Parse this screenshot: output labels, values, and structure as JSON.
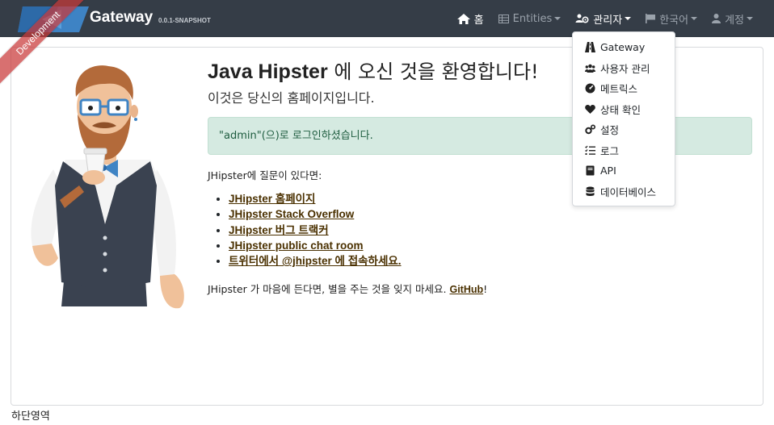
{
  "brand": {
    "title": "Gateway",
    "version": "0.0.1-SNAPSHOT",
    "ribbon": "Development"
  },
  "nav": {
    "home": "홈",
    "entities": "Entities",
    "admin": "관리자",
    "language": "한국어",
    "account": "계정"
  },
  "admin_menu": {
    "items": [
      {
        "label": "Gateway",
        "icon": "road-icon"
      },
      {
        "label": "사용자 관리",
        "icon": "users-icon"
      },
      {
        "label": "메트릭스",
        "icon": "tachometer-icon"
      },
      {
        "label": "상태 확인",
        "icon": "heart-icon"
      },
      {
        "label": "설정",
        "icon": "cogs-icon"
      },
      {
        "label": "로그",
        "icon": "tasks-icon"
      },
      {
        "label": "API",
        "icon": "book-icon"
      },
      {
        "label": "데이터베이스",
        "icon": "database-icon"
      }
    ]
  },
  "home": {
    "title_bold": "Java Hipster",
    "title_rest": " 에 오신 것을 환영합니다!",
    "subtitle": "이것은 당신의 홈페이지입니다.",
    "alert": "\"admin\"(으)로 로그인하셨습니다.",
    "question": "JHipster에 질문이 있다면:",
    "links": [
      "JHipster 홈페이지",
      "JHipster Stack Overflow",
      "JHipster 버그 트랙커",
      "JHipster public chat room",
      "트위터에서 @jhipster 에 접속하세요."
    ],
    "github_text": "JHipster 가 마음에 든다면, 별을 주는 것을 잊지 마세요.",
    "github_link": "GitHub",
    "github_after": "!"
  },
  "footer": "하단영역",
  "colors": {
    "navbar": "#353d47",
    "alert_bg": "#d5eae1",
    "link": "#4a3000",
    "ribbon": "#c93939"
  }
}
